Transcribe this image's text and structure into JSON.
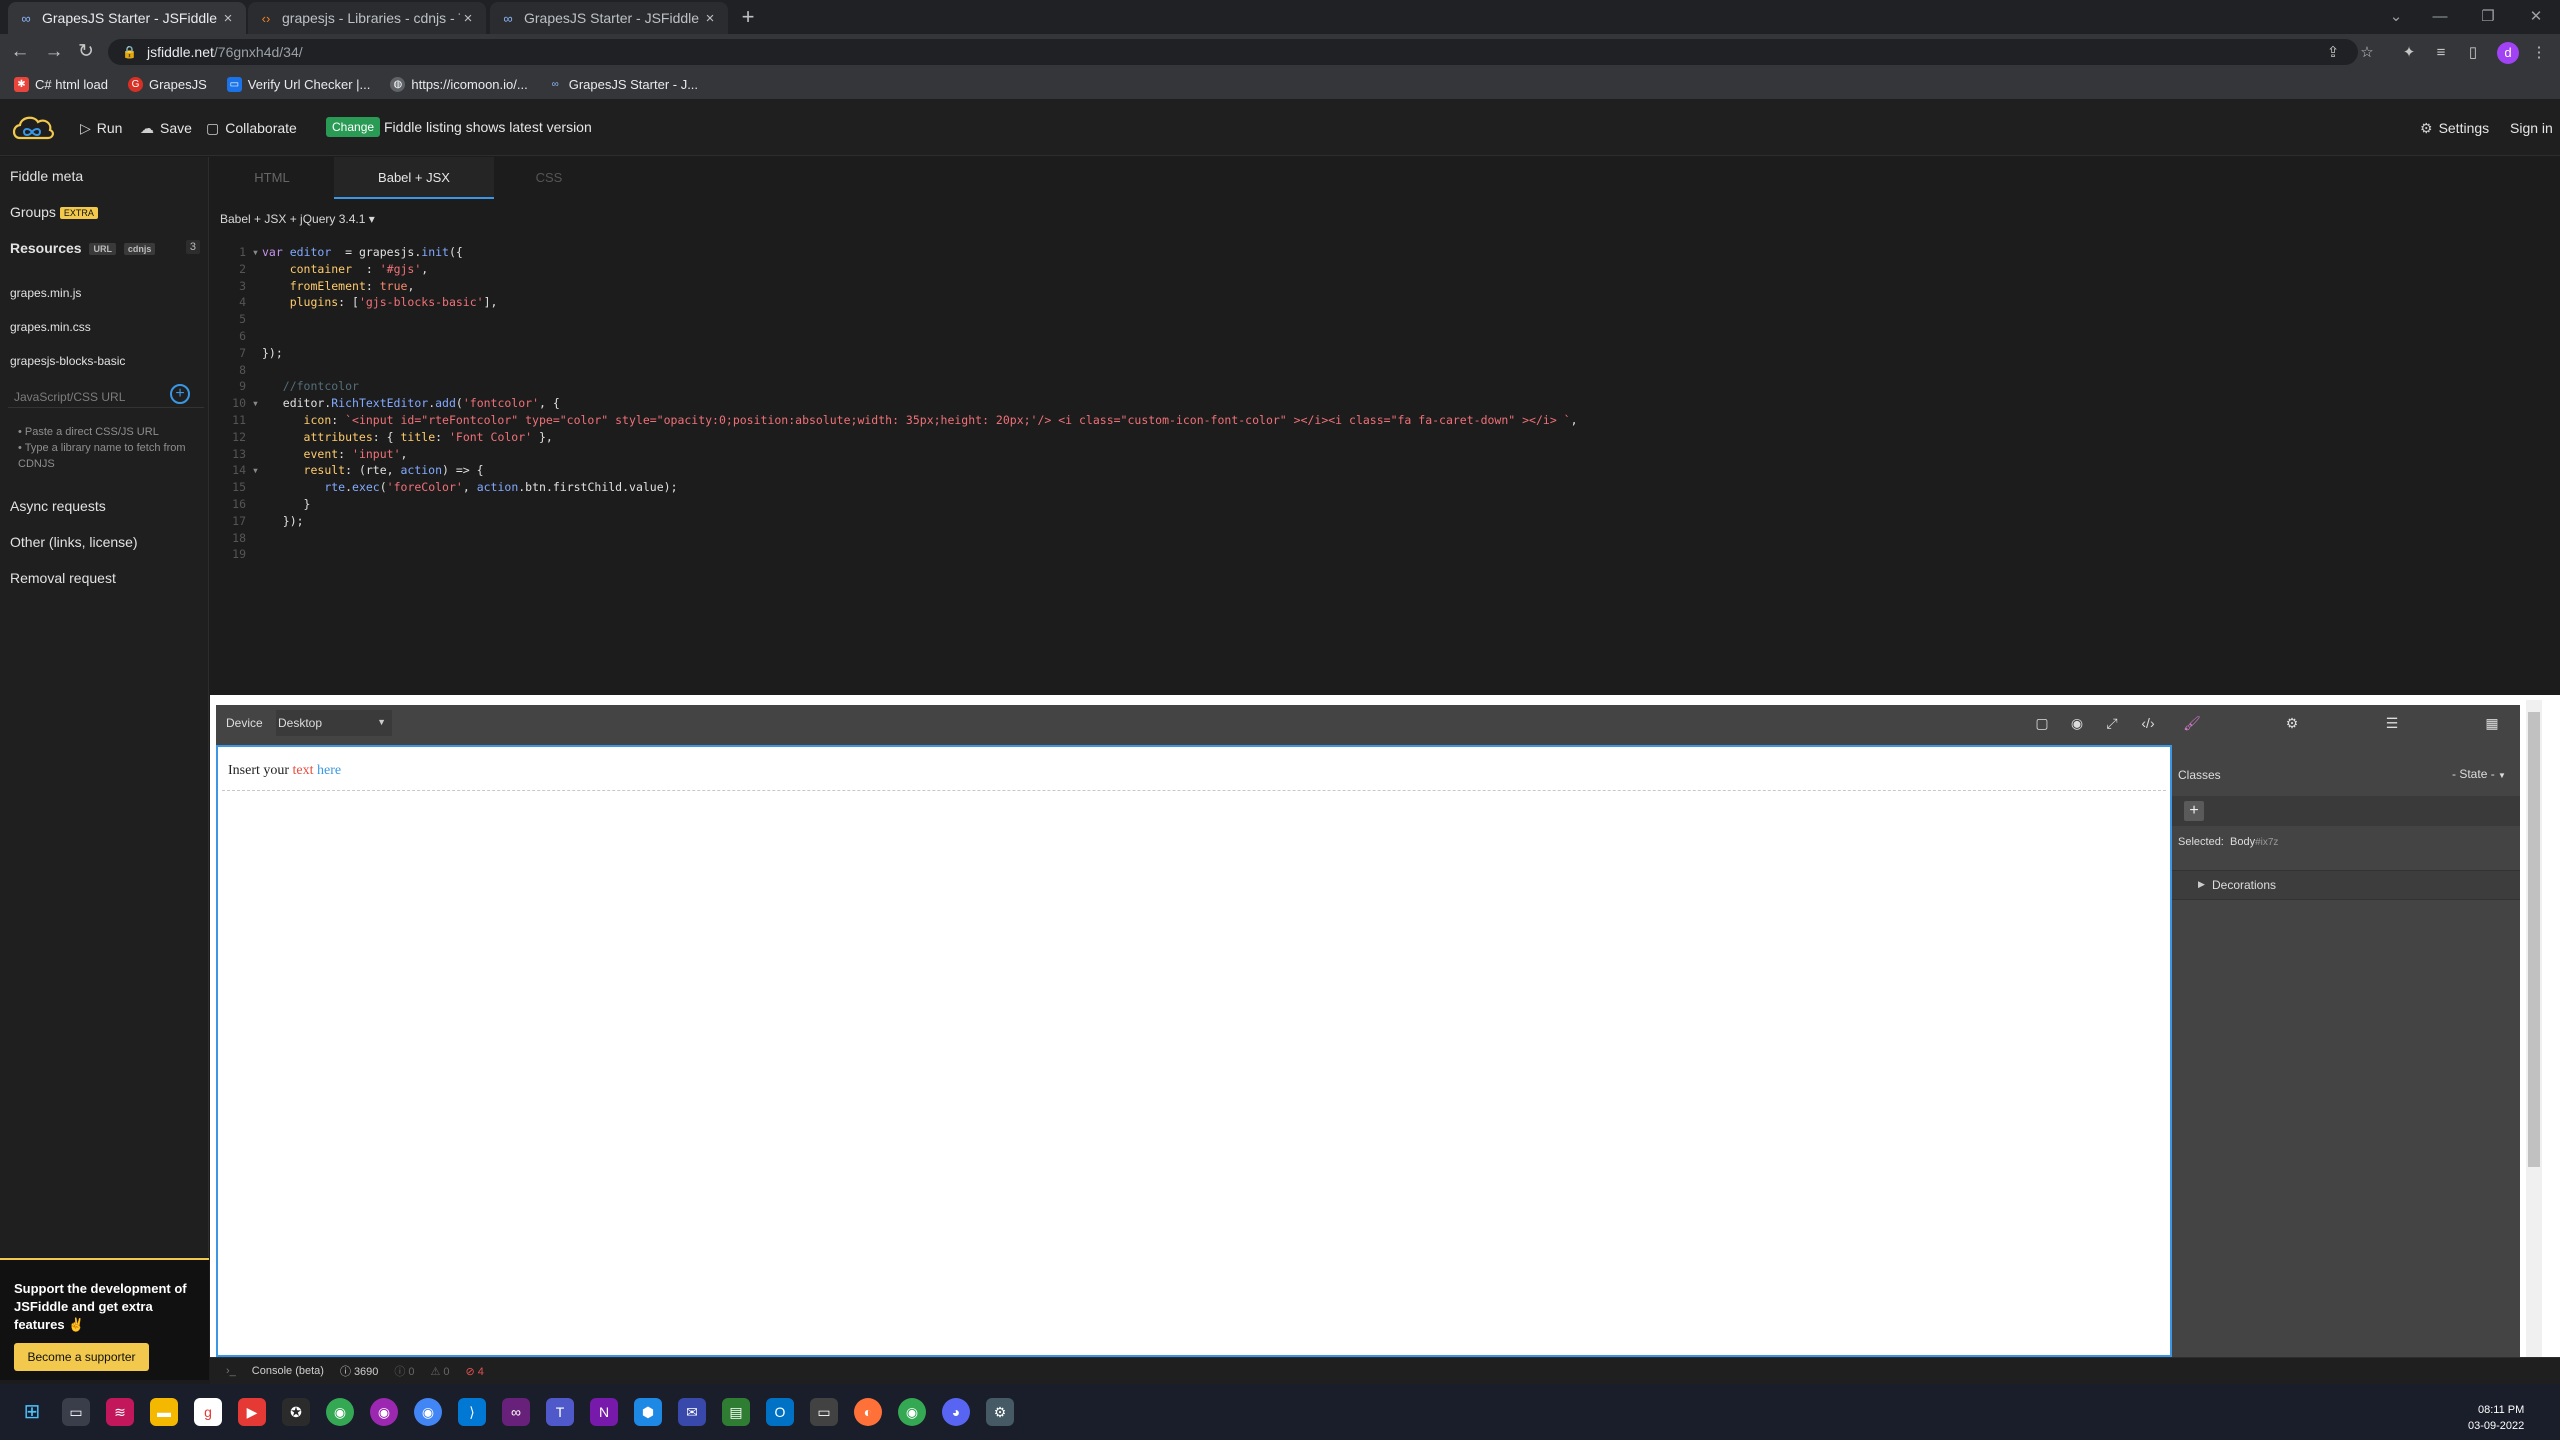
{
  "browser": {
    "tabs": [
      {
        "title": "GrapesJS Starter - JSFiddle - Code"
      },
      {
        "title": "grapesjs - Libraries - cdnjs - The"
      },
      {
        "title": "GrapesJS Starter - JSFiddle - Code"
      }
    ],
    "url_host": "jsfiddle.net",
    "url_path": "/76gnxh4d/34/",
    "profile_initial": "d",
    "bookmarks": [
      {
        "label": "C# html load"
      },
      {
        "label": "GrapesJS"
      },
      {
        "label": "Verify Url Checker |..."
      },
      {
        "label": "https://icomoon.io/..."
      },
      {
        "label": "GrapesJS Starter - J..."
      }
    ]
  },
  "header": {
    "run": "Run",
    "save": "Save",
    "collaborate": "Collaborate",
    "change": "Change",
    "listing": "Fiddle listing shows latest version",
    "settings": "Settings",
    "signin": "Sign in"
  },
  "sidebar": {
    "fiddle_meta": "Fiddle meta",
    "groups": "Groups",
    "groups_badge": "EXTRA",
    "resources": "Resources",
    "res_badge_url": "URL",
    "res_badge_cdnjs": "cdnjs",
    "res_count": "3",
    "resources_list": [
      "grapes.min.js",
      "grapes.min.css",
      "grapesjs-blocks-basic"
    ],
    "url_placeholder": "JavaScript/CSS URL",
    "hint1": "Paste a direct CSS/JS URL",
    "hint2": "Type a library name to fetch from CDNJS",
    "async": "Async requests",
    "other": "Other (links, license)",
    "removal": "Removal request",
    "support_text": "Support the development of JSFiddle and get extra features ✌",
    "supporter_btn": "Become a supporter"
  },
  "editor": {
    "tabs": [
      "HTML",
      "Babel + JSX",
      "CSS"
    ],
    "active_tab": "Babel + JSX",
    "language": "Babel + JSX + jQuery 3.4.1 ▾"
  },
  "gjs": {
    "device_label": "Device",
    "device_value": "Desktop",
    "canvas_text_1": "Insert your ",
    "canvas_text_2": "text",
    "canvas_text_3": " here",
    "classes": "Classes",
    "state": "- State -",
    "selected": "Selected:",
    "selected_name": "Body",
    "selected_id": "#ix7z",
    "decorations": "Decorations"
  },
  "console": {
    "label": "Console (beta)",
    "count1": "3690",
    "count2": "0",
    "count3": "0",
    "count4": "4"
  },
  "clock": {
    "time": "08:11 PM",
    "date": "03-09-2022"
  },
  "colors": {
    "accent_blue": "#3b97e3",
    "change_green": "#2a9b55",
    "supporter_yellow": "#f2c94c"
  }
}
